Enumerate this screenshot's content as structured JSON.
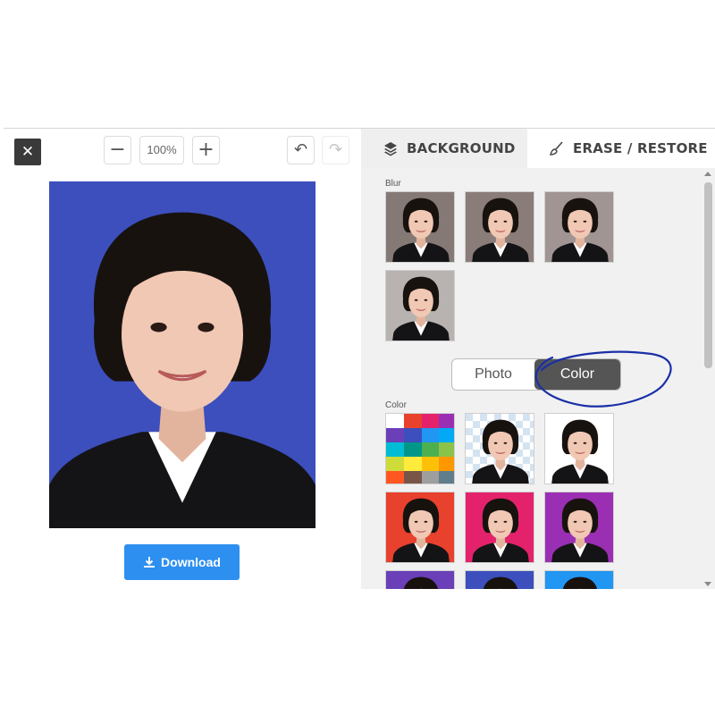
{
  "toolbar": {
    "close_icon": "close-icon",
    "zoom_out_icon": "minus-icon",
    "zoom_level": "100%",
    "zoom_in_icon": "plus-icon",
    "undo_icon": "undo-icon",
    "redo_icon": "redo-icon"
  },
  "preview": {
    "background_color": "#3c4fbd",
    "download_label": "Download",
    "download_color": "#2d8ff0"
  },
  "tabs": {
    "background_label": "BACKGROUND",
    "background_icon": "layers-icon",
    "erase_label": "ERASE / RESTORE",
    "erase_icon": "brush-icon"
  },
  "blur_section": {
    "label": "Blur",
    "thumbnail_count": 4
  },
  "mode_toggle": {
    "photo_label": "Photo",
    "color_label": "Color",
    "selected": "Color"
  },
  "color_section": {
    "label": "Color",
    "swatches": [
      "palette",
      "transparent",
      "#ffffff",
      "#e8412d",
      "#e4226b",
      "#9b2fb4",
      "#6a3fb8",
      "#3c4fbd",
      "#2196f3"
    ]
  },
  "annotation": {
    "color": "#1a2fa8"
  }
}
